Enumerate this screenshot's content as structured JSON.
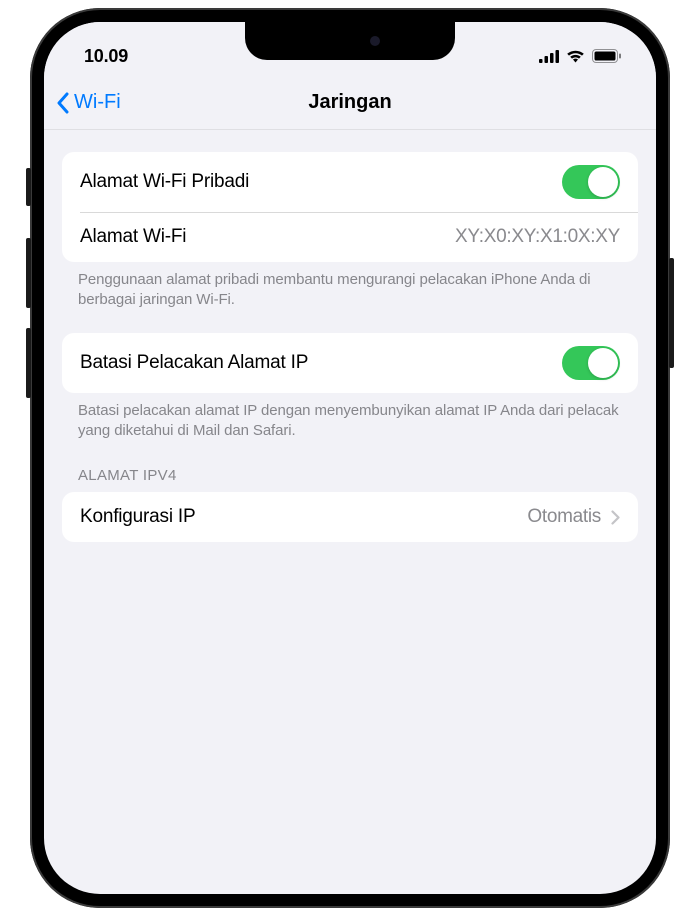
{
  "status": {
    "time": "10.09"
  },
  "nav": {
    "back_label": "Wi-Fi",
    "title": "Jaringan"
  },
  "group1": {
    "private_address_label": "Alamat Wi-Fi Pribadi",
    "private_address_on": true,
    "wifi_address_label": "Alamat Wi-Fi",
    "wifi_address_value": "XY:X0:XY:X1:0X:XY",
    "footer": "Penggunaan alamat pribadi membantu mengurangi pelacakan iPhone Anda di berbagai jaringan Wi-Fi."
  },
  "group2": {
    "limit_ip_label": "Batasi Pelacakan Alamat IP",
    "limit_ip_on": true,
    "footer": "Batasi pelacakan alamat IP dengan menyembunyikan alamat IP Anda dari pelacak yang diketahui di Mail dan Safari."
  },
  "ipv4": {
    "header": "ALAMAT IPV4",
    "configure_label": "Konfigurasi IP",
    "configure_value": "Otomatis"
  },
  "colors": {
    "accent": "#007aff",
    "toggle_on": "#34c759"
  }
}
